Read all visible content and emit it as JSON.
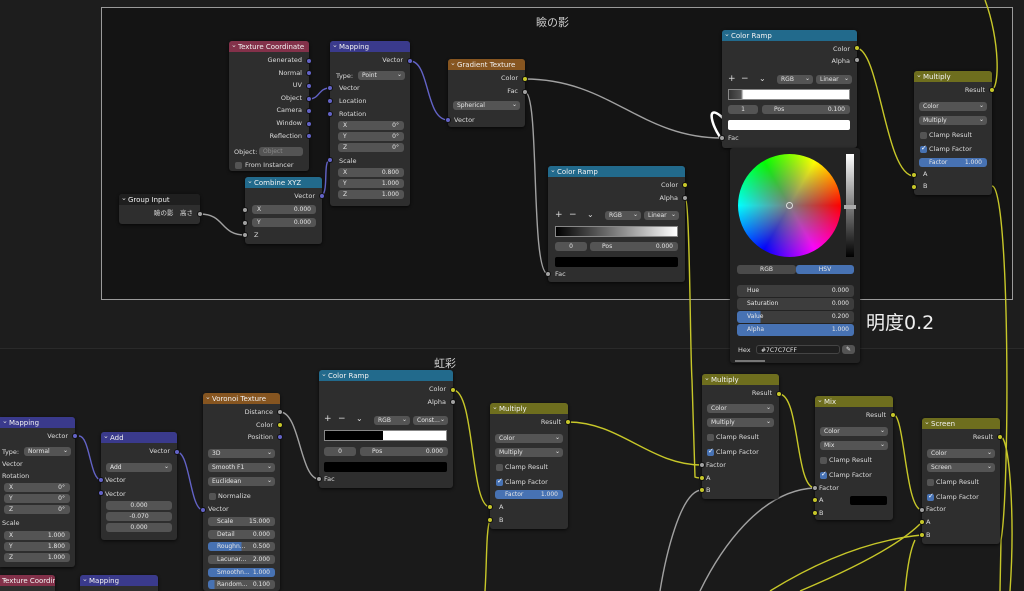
{
  "frames": {
    "top": {
      "title": "瞼の影"
    },
    "bottom": {
      "title": "虹彩"
    }
  },
  "annotation": "明度0.2",
  "texture_coordinate": {
    "title": "Texture Coordinate",
    "outputs": [
      "Generated",
      "Normal",
      "UV",
      "Object",
      "Camera",
      "Window",
      "Reflection"
    ],
    "object_label": "Object:",
    "object_placeholder": "Object",
    "from_instancer": "From Instancer"
  },
  "mapping_top": {
    "title": "Mapping",
    "output": "Vector",
    "type_label": "Type:",
    "type_value": "Point",
    "inputs": [
      "Vector",
      "Location",
      "Rotation"
    ],
    "rotation": [
      {
        "axis": "X",
        "value": "0°"
      },
      {
        "axis": "Y",
        "value": "0°"
      },
      {
        "axis": "Z",
        "value": "0°"
      }
    ],
    "scale_label": "Scale",
    "scale": [
      {
        "axis": "X",
        "value": "0.800"
      },
      {
        "axis": "Y",
        "value": "1.000"
      },
      {
        "axis": "Z",
        "value": "1.000"
      }
    ]
  },
  "gradient_texture": {
    "title": "Gradient Texture",
    "outputs": [
      "Color",
      "Fac"
    ],
    "type_value": "Spherical",
    "input": "Vector"
  },
  "group_input": {
    "title": "Group Input",
    "output": "瞼の影　高さ"
  },
  "combine_xyz": {
    "title": "Combine XYZ",
    "output": "Vector",
    "x": "0.000",
    "y": "0.000",
    "x_label": "X",
    "y_label": "Y",
    "z_label": "Z"
  },
  "color_ramp_top": {
    "title": "Color Ramp",
    "outputs": [
      "Color",
      "Alpha"
    ],
    "mode": "RGB",
    "interp": "Linear",
    "index": "1",
    "pos_label": "Pos",
    "pos": "0.100",
    "input": "Fac"
  },
  "color_ramp_mid": {
    "title": "Color Ramp",
    "outputs": [
      "Color",
      "Alpha"
    ],
    "mode": "RGB",
    "interp": "Linear",
    "index": "0",
    "pos_label": "Pos",
    "pos": "0.000",
    "input": "Fac"
  },
  "color_picker": {
    "tabs": [
      "RGB",
      "HSV"
    ],
    "active_tab": "HSV",
    "fields": [
      {
        "label": "Hue",
        "value": "0.000"
      },
      {
        "label": "Saturation",
        "value": "0.000"
      },
      {
        "label": "Value",
        "value": "0.200"
      },
      {
        "label": "Alpha",
        "value": "1.000"
      }
    ],
    "hex_label": "Hex",
    "hex_value": "#7C7C7CFF"
  },
  "multiply_top": {
    "title": "Multiply",
    "output": "Result",
    "type": "Color",
    "blend": "Multiply",
    "clamp_result": "Clamp Result",
    "clamp_factor": "Clamp Factor",
    "factor_label": "Factor",
    "factor_value": "1.000",
    "inputs": [
      "A",
      "B"
    ]
  },
  "mapping_bottom": {
    "title": "Mapping",
    "output": "Vector",
    "type_label": "Type:",
    "type_value": "Normal",
    "inputs": [
      "Vector",
      "Rotation"
    ],
    "rotation": [
      {
        "axis": "X",
        "value": "0°"
      },
      {
        "axis": "Y",
        "value": "0°"
      },
      {
        "axis": "Z",
        "value": "0°"
      }
    ],
    "scale_label": "Scale",
    "scale": [
      {
        "axis": "X",
        "value": "1.000"
      },
      {
        "axis": "Y",
        "value": "1.800"
      },
      {
        "axis": "Z",
        "value": "1.000"
      }
    ]
  },
  "add": {
    "title": "Add",
    "output": "Vector",
    "op": "Add",
    "inputs": [
      "Vector",
      "Vector"
    ],
    "values": [
      "0.000",
      "-0.070",
      "0.000"
    ]
  },
  "voronoi": {
    "title": "Voronoi Texture",
    "outputs": [
      "Distance",
      "Color",
      "Position"
    ],
    "dim": "3D",
    "feature": "Smooth F1",
    "metric": "Euclidean",
    "normalize": "Normalize",
    "input": "Vector",
    "params": [
      {
        "label": "Scale",
        "value": "15.000",
        "blue": false
      },
      {
        "label": "Detail",
        "value": "0.000",
        "blue": false
      },
      {
        "label": "Roughn...",
        "value": "0.500",
        "blue": true
      },
      {
        "label": "Lacunar...",
        "value": "2.000",
        "blue": false
      },
      {
        "label": "Smoothn...",
        "value": "1.000",
        "blue": true
      },
      {
        "label": "Random...",
        "value": "0.100",
        "blue": true
      }
    ]
  },
  "color_ramp_bottom": {
    "title": "Color Ramp",
    "outputs": [
      "Color",
      "Alpha"
    ],
    "mode": "RGB",
    "interp": "Const...",
    "index": "0",
    "pos_label": "Pos",
    "pos": "0.000",
    "input": "Fac"
  },
  "multiply_b1": {
    "title": "Multiply",
    "output": "Result",
    "type": "Color",
    "blend": "Multiply",
    "clamp_result": "Clamp Result",
    "clamp_factor": "Clamp Factor",
    "factor_label": "Factor",
    "factor_value": "1.000",
    "inputs": [
      "A",
      "B"
    ]
  },
  "multiply_b2": {
    "title": "Multiply",
    "output": "Result",
    "type": "Color",
    "blend": "Multiply",
    "clamp_result": "Clamp Result",
    "clamp_factor": "Clamp Factor",
    "factor_label": "Factor",
    "inputs": [
      "A",
      "B"
    ]
  },
  "mix": {
    "title": "Mix",
    "output": "Result",
    "type": "Color",
    "blend": "Mix",
    "clamp_result": "Clamp Result",
    "clamp_factor": "Clamp Factor",
    "factor_label": "Factor",
    "inputs": [
      "A",
      "B"
    ]
  },
  "screen": {
    "title": "Screen",
    "output": "Result",
    "type": "Color",
    "blend": "Screen",
    "clamp_result": "Clamp Result",
    "clamp_factor": "Clamp Factor",
    "factor_label": "Factor",
    "inputs": [
      "A",
      "B"
    ]
  },
  "partial": {
    "tex_coord": "Texture Coordinate",
    "mapping": "Mapping"
  },
  "colors": {
    "input_header": "#83314a",
    "vector_header": "#3a3a8c",
    "texture_header": "#865520",
    "converter_header": "#226a8c",
    "math_header": "#6e6e1e",
    "vector_socket": "#6363c7",
    "color_socket": "#c7c729",
    "float_socket": "#a1a1a1",
    "accent": "#4772b3"
  }
}
